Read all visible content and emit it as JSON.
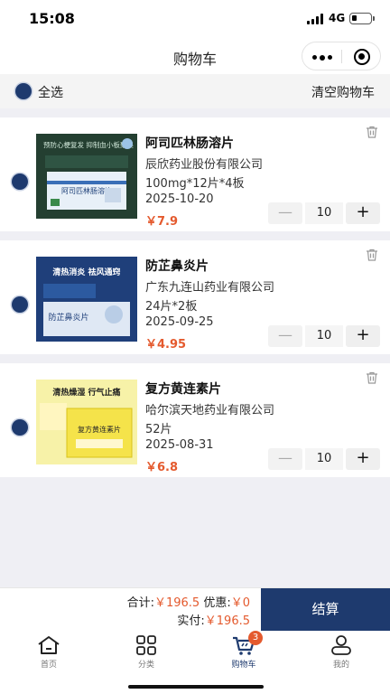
{
  "status_bar": {
    "time": "15:08",
    "network": "4G"
  },
  "nav": {
    "title": "购物车"
  },
  "select_bar": {
    "select_all": "全选",
    "clear_cart": "清空购物车"
  },
  "items": [
    {
      "name": "阿司匹林肠溶片",
      "manufacturer": "辰欣药业股份有限公司",
      "spec": "100mg*12片*4板",
      "date": "2025-10-20",
      "price": "￥7.9",
      "quantity": "10",
      "box": {
        "banner": "预防心梗复发 抑制血小板聚集",
        "product": "阿司匹林肠溶片"
      }
    },
    {
      "name": "防芷鼻炎片",
      "manufacturer": "广东九连山药业有限公司",
      "spec": "24片*2板",
      "date": "2025-09-25",
      "price": "￥4.95",
      "quantity": "10",
      "box": {
        "banner": "清热消炎 祛风通窍",
        "product": "防芷鼻炎片"
      }
    },
    {
      "name": "复方黄连素片",
      "manufacturer": "哈尔滨天地药业有限公司",
      "spec": "52片",
      "date": "2025-08-31",
      "price": "￥6.8",
      "quantity": "10",
      "box": {
        "banner": "清热燥湿 行气止痛",
        "product": "复方黄连素片"
      }
    }
  ],
  "footer": {
    "total_label": "合计:",
    "total_value": "￥196.5",
    "discount_label": "优惠:",
    "discount_value": "￥0",
    "paid_label": "实付:",
    "paid_value": "￥196.5",
    "checkout": "结算"
  },
  "tabs": [
    {
      "label": "首页",
      "icon": "home-icon"
    },
    {
      "label": "分类",
      "icon": "grid-icon"
    },
    {
      "label": "购物车",
      "icon": "cart-icon",
      "badge": "3"
    },
    {
      "label": "我的",
      "icon": "user-icon"
    }
  ],
  "colors": {
    "primary": "#1e3a6e",
    "price": "#e45a2e",
    "badge": "#e45a2e"
  }
}
